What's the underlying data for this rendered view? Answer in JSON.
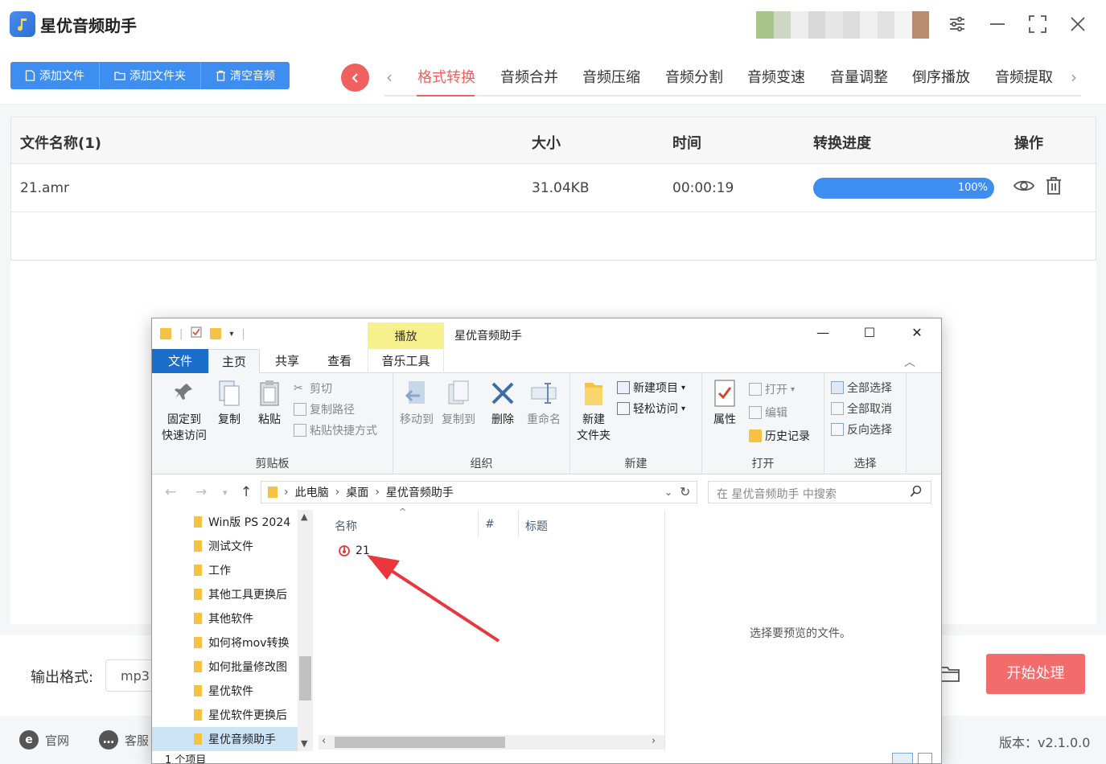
{
  "app": {
    "title": "星优音频助手",
    "logo_icon": "music-note-icon"
  },
  "toolbar": {
    "add_file": "添加文件",
    "add_folder": "添加文件夹",
    "clear_audio": "清空音频"
  },
  "tabs": [
    "格式转换",
    "音频合并",
    "音频压缩",
    "音频分割",
    "音频变速",
    "音量调整",
    "倒序播放",
    "音频提取"
  ],
  "active_tab": "格式转换",
  "table": {
    "headers": {
      "name": "文件名称(1)",
      "size": "大小",
      "time": "时间",
      "progress": "转换进度",
      "action": "操作"
    },
    "rows": [
      {
        "name": "21.amr",
        "size": "31.04KB",
        "time": "00:00:19",
        "progress_label": "100%",
        "progress": 1.0
      }
    ]
  },
  "bottom": {
    "output_format_label": "输出格式:",
    "output_format_value": "mp3",
    "start_button": "开始处理"
  },
  "footer": {
    "website": "官网",
    "support": "客服",
    "version": "版本：v2.1.0.0"
  },
  "explorer": {
    "context_tab": "播放",
    "window_title": "星优音频助手",
    "ribbon_tabs": {
      "file": "文件",
      "home": "主页",
      "share": "共享",
      "view": "查看",
      "music": "音乐工具"
    },
    "clipboard": {
      "pin": "固定到\n快速访问",
      "copy": "复制",
      "paste": "粘贴",
      "cut": "剪切",
      "copy_path": "复制路径",
      "paste_shortcut": "粘贴快捷方式",
      "label": "剪贴板"
    },
    "organize": {
      "move_to": "移动到",
      "copy_to": "复制到",
      "delete": "删除",
      "rename": "重命名",
      "label": "组织"
    },
    "new": {
      "new_folder": "新建\n文件夹",
      "new_item": "新建项目",
      "easy_access": "轻松访问",
      "label": "新建"
    },
    "open": {
      "properties": "属性",
      "open": "打开",
      "edit": "编辑",
      "history": "历史记录",
      "label": "打开"
    },
    "select": {
      "select_all": "全部选择",
      "select_none": "全部取消",
      "invert": "反向选择",
      "label": "选择"
    },
    "breadcrumb": [
      "此电脑",
      "桌面",
      "星优音频助手"
    ],
    "search_placeholder": "在 星优音频助手 中搜索",
    "nav_items": [
      "Win版 PS 2024",
      "测试文件",
      "工作",
      "其他工具更换后",
      "其他软件",
      "如何将mov转换",
      "如何批量修改图",
      "星优软件",
      "星优软件更换后",
      "星优音频助手"
    ],
    "columns": {
      "name": "名称",
      "number": "#",
      "title": "标题"
    },
    "files": [
      {
        "name": "21",
        "icon": "audio-file-icon"
      }
    ],
    "preview_text": "选择要预览的文件。",
    "status": "1 个项目"
  },
  "colors": {
    "accent_blue": "#3d8ef0",
    "accent_red": "#f0605e",
    "start_button": "#f36c6c",
    "explorer_file_tab": "#1a6dc8",
    "context_tab": "#f7f08d",
    "annotation_arrow": "#e8383d"
  }
}
